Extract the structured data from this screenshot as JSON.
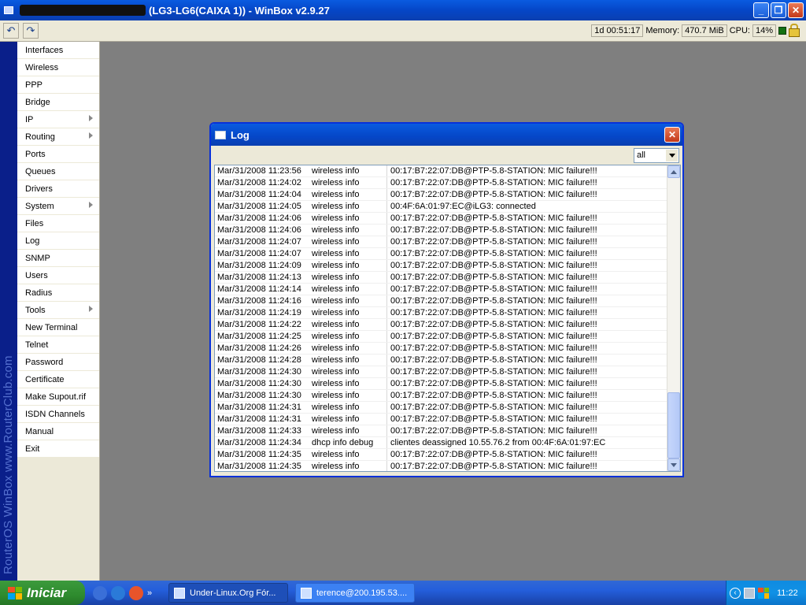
{
  "window": {
    "title": "(LG3-LG6(CAIXA 1)) - WinBox v2.9.27",
    "minimize_glyph": "_",
    "maximize_glyph": "❐",
    "close_glyph": "✕"
  },
  "toolbar": {
    "undo_icon": "undo-icon",
    "redo_icon": "redo-icon",
    "undo_glyph": "↶",
    "redo_glyph": "↷",
    "uptime": "1d 00:51:17",
    "memory_label": "Memory:",
    "memory_value": "470.7 MiB",
    "cpu_label": "CPU:",
    "cpu_value": "14%"
  },
  "brand": {
    "text": "RouterOS WinBox   www.RouterClub.com"
  },
  "sidebar": {
    "items": [
      {
        "label": "Interfaces",
        "submenu": false
      },
      {
        "label": "Wireless",
        "submenu": false
      },
      {
        "label": "PPP",
        "submenu": false
      },
      {
        "label": "Bridge",
        "submenu": false
      },
      {
        "label": "IP",
        "submenu": true
      },
      {
        "label": "Routing",
        "submenu": true
      },
      {
        "label": "Ports",
        "submenu": false
      },
      {
        "label": "Queues",
        "submenu": false
      },
      {
        "label": "Drivers",
        "submenu": false
      },
      {
        "label": "System",
        "submenu": true
      },
      {
        "label": "Files",
        "submenu": false
      },
      {
        "label": "Log",
        "submenu": false
      },
      {
        "label": "SNMP",
        "submenu": false
      },
      {
        "label": "Users",
        "submenu": false
      },
      {
        "label": "Radius",
        "submenu": false
      },
      {
        "label": "Tools",
        "submenu": true
      },
      {
        "label": "New Terminal",
        "submenu": false
      },
      {
        "label": "Telnet",
        "submenu": false
      },
      {
        "label": "Password",
        "submenu": false
      },
      {
        "label": "Certificate",
        "submenu": false
      },
      {
        "label": "Make Supout.rif",
        "submenu": false
      },
      {
        "label": "ISDN Channels",
        "submenu": false
      },
      {
        "label": "Manual",
        "submenu": false
      },
      {
        "label": "Exit",
        "submenu": false
      }
    ]
  },
  "log_window": {
    "title": "Log",
    "close_glyph": "✕",
    "filter_value": "all",
    "entries": [
      {
        "time": "Mar/31/2008 11:23:56",
        "topics": "wireless info",
        "message": "00:17:B7:22:07:DB@PTP-5.8-STATION: MIC failure!!!"
      },
      {
        "time": "Mar/31/2008 11:24:02",
        "topics": "wireless info",
        "message": "00:17:B7:22:07:DB@PTP-5.8-STATION: MIC failure!!!"
      },
      {
        "time": "Mar/31/2008 11:24:04",
        "topics": "wireless info",
        "message": "00:17:B7:22:07:DB@PTP-5.8-STATION: MIC failure!!!"
      },
      {
        "time": "Mar/31/2008 11:24:05",
        "topics": "wireless info",
        "message": "00:4F:6A:01:97:EC@iLG3: connected"
      },
      {
        "time": "Mar/31/2008 11:24:06",
        "topics": "wireless info",
        "message": "00:17:B7:22:07:DB@PTP-5.8-STATION: MIC failure!!!"
      },
      {
        "time": "Mar/31/2008 11:24:06",
        "topics": "wireless info",
        "message": "00:17:B7:22:07:DB@PTP-5.8-STATION: MIC failure!!!"
      },
      {
        "time": "Mar/31/2008 11:24:07",
        "topics": "wireless info",
        "message": "00:17:B7:22:07:DB@PTP-5.8-STATION: MIC failure!!!"
      },
      {
        "time": "Mar/31/2008 11:24:07",
        "topics": "wireless info",
        "message": "00:17:B7:22:07:DB@PTP-5.8-STATION: MIC failure!!!"
      },
      {
        "time": "Mar/31/2008 11:24:09",
        "topics": "wireless info",
        "message": "00:17:B7:22:07:DB@PTP-5.8-STATION: MIC failure!!!"
      },
      {
        "time": "Mar/31/2008 11:24:13",
        "topics": "wireless info",
        "message": "00:17:B7:22:07:DB@PTP-5.8-STATION: MIC failure!!!"
      },
      {
        "time": "Mar/31/2008 11:24:14",
        "topics": "wireless info",
        "message": "00:17:B7:22:07:DB@PTP-5.8-STATION: MIC failure!!!"
      },
      {
        "time": "Mar/31/2008 11:24:16",
        "topics": "wireless info",
        "message": "00:17:B7:22:07:DB@PTP-5.8-STATION: MIC failure!!!"
      },
      {
        "time": "Mar/31/2008 11:24:19",
        "topics": "wireless info",
        "message": "00:17:B7:22:07:DB@PTP-5.8-STATION: MIC failure!!!"
      },
      {
        "time": "Mar/31/2008 11:24:22",
        "topics": "wireless info",
        "message": "00:17:B7:22:07:DB@PTP-5.8-STATION: MIC failure!!!"
      },
      {
        "time": "Mar/31/2008 11:24:25",
        "topics": "wireless info",
        "message": "00:17:B7:22:07:DB@PTP-5.8-STATION: MIC failure!!!"
      },
      {
        "time": "Mar/31/2008 11:24:26",
        "topics": "wireless info",
        "message": "00:17:B7:22:07:DB@PTP-5.8-STATION: MIC failure!!!"
      },
      {
        "time": "Mar/31/2008 11:24:28",
        "topics": "wireless info",
        "message": "00:17:B7:22:07:DB@PTP-5.8-STATION: MIC failure!!!"
      },
      {
        "time": "Mar/31/2008 11:24:30",
        "topics": "wireless info",
        "message": "00:17:B7:22:07:DB@PTP-5.8-STATION: MIC failure!!!"
      },
      {
        "time": "Mar/31/2008 11:24:30",
        "topics": "wireless info",
        "message": "00:17:B7:22:07:DB@PTP-5.8-STATION: MIC failure!!!"
      },
      {
        "time": "Mar/31/2008 11:24:30",
        "topics": "wireless info",
        "message": "00:17:B7:22:07:DB@PTP-5.8-STATION: MIC failure!!!"
      },
      {
        "time": "Mar/31/2008 11:24:31",
        "topics": "wireless info",
        "message": "00:17:B7:22:07:DB@PTP-5.8-STATION: MIC failure!!!"
      },
      {
        "time": "Mar/31/2008 11:24:31",
        "topics": "wireless info",
        "message": "00:17:B7:22:07:DB@PTP-5.8-STATION: MIC failure!!!"
      },
      {
        "time": "Mar/31/2008 11:24:33",
        "topics": "wireless info",
        "message": "00:17:B7:22:07:DB@PTP-5.8-STATION: MIC failure!!!"
      },
      {
        "time": "Mar/31/2008 11:24:34",
        "topics": "dhcp info debug",
        "message": "clientes deassigned 10.55.76.2 from 00:4F:6A:01:97:EC"
      },
      {
        "time": "Mar/31/2008 11:24:35",
        "topics": "wireless info",
        "message": "00:17:B7:22:07:DB@PTP-5.8-STATION: MIC failure!!!"
      },
      {
        "time": "Mar/31/2008 11:24:35",
        "topics": "wireless info",
        "message": "00:17:B7:22:07:DB@PTP-5.8-STATION: MIC failure!!!"
      }
    ]
  },
  "taskbar": {
    "start_label": "Iniciar",
    "quick_launch": [
      "settings-icon",
      "internet-explorer-icon",
      "firefox-icon"
    ],
    "quick_launch_colors": [
      "#3a6fd8",
      "#2a7ad8",
      "#e8542a"
    ],
    "quick_launch_more": "»",
    "tasks": [
      {
        "label": "Under-Linux.Org Fór...",
        "active": true
      },
      {
        "label": "terence@200.195.53....",
        "active": false
      }
    ],
    "tray_chevron": "‹",
    "tray_icons": [
      "network-icon",
      "windows-flag-icon"
    ],
    "clock": "11:22"
  }
}
